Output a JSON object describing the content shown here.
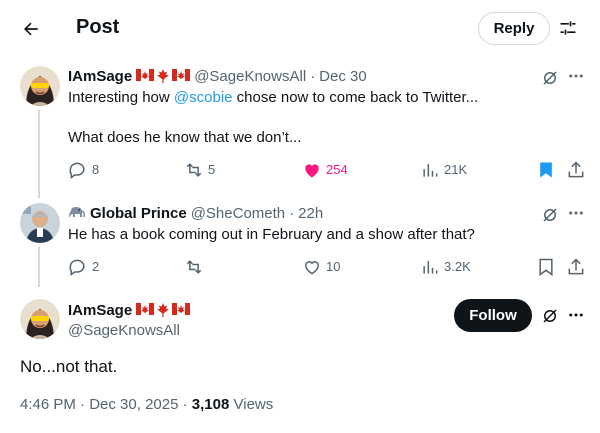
{
  "header": {
    "title": "Post",
    "reply_label": "Reply"
  },
  "tweets": [
    {
      "display_name": "IAmSage",
      "handle": "@SageKnowsAll",
      "separator": "·",
      "date": "Dec 30",
      "text_before": "Interesting how ",
      "mention": "@scobie",
      "text_after": " chose now to come back to Twitter...",
      "text_line2": "What does he know that we don’t...",
      "replies": "8",
      "reposts": "5",
      "likes": "254",
      "views": "21K",
      "liked": true,
      "bookmarked": true
    },
    {
      "display_name": "Global Prince",
      "handle": "@SheCometh",
      "separator": "·",
      "date": "22h",
      "text": "He has a book coming out in February and a show after that?",
      "replies": "2",
      "reposts": "",
      "likes": "10",
      "views": "3.2K",
      "liked": false,
      "bookmarked": false
    }
  ],
  "main_post": {
    "display_name": "IAmSage",
    "handle": "@SageKnowsAll",
    "follow_label": "Follow",
    "text": "No...not that.",
    "time": "4:46 PM",
    "date": "Dec 30, 2025",
    "views_count": "3,108",
    "views_label": "Views",
    "separator": "·"
  },
  "colors": {
    "accent": "#1d9bf0",
    "like_active": "#f91880",
    "text_primary": "#0f1419",
    "text_secondary": "#536471",
    "border": "#cfd9de"
  },
  "icons": [
    "back-arrow-icon",
    "filter-icon",
    "grok-icon",
    "more-icon",
    "reply-icon",
    "repost-icon",
    "like-icon",
    "views-icon",
    "bookmark-icon",
    "share-icon",
    "canada-flag-icon",
    "elephant-icon"
  ]
}
